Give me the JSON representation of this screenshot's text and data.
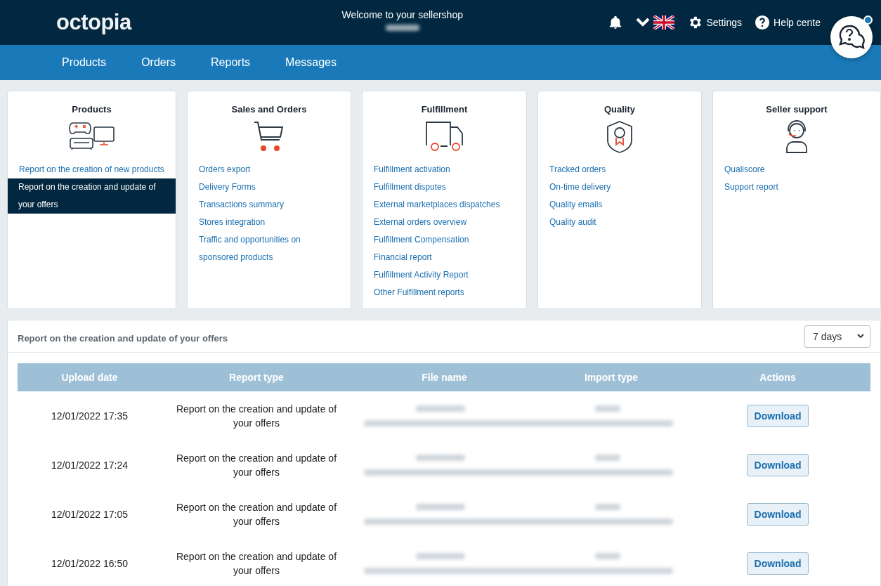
{
  "header": {
    "logo": "octopia",
    "welcome": "Welcome to your sellershop",
    "settings": "Settings",
    "help": "Help cente"
  },
  "nav": [
    "Products",
    "Orders",
    "Reports",
    "Messages"
  ],
  "cards": [
    {
      "title": "Products",
      "kind": "products",
      "links": [
        {
          "label": "Report on the creation of new products",
          "selected": false
        },
        {
          "label": "Report on the creation and update of your offers",
          "selected": true
        }
      ]
    },
    {
      "title": "Sales and Orders",
      "kind": "cart",
      "links": [
        {
          "label": "Orders export",
          "selected": false
        },
        {
          "label": "Delivery Forms",
          "selected": false
        },
        {
          "label": "Transactions summary",
          "selected": false
        },
        {
          "label": "Stores integration",
          "selected": false
        },
        {
          "label": "Traffic and opportunities on sponsored products",
          "selected": false
        }
      ]
    },
    {
      "title": "Fulfillment",
      "kind": "truck",
      "links": [
        {
          "label": "Fulfillment activation",
          "selected": false
        },
        {
          "label": "Fulfillment disputes",
          "selected": false
        },
        {
          "label": "External marketplaces dispatches",
          "selected": false
        },
        {
          "label": "External orders overview",
          "selected": false
        },
        {
          "label": "Fulfillment Compensation",
          "selected": false
        },
        {
          "label": "Financial report",
          "selected": false
        },
        {
          "label": "Fulfillment Activity Report",
          "selected": false
        },
        {
          "label": "Other Fulfillment reports",
          "selected": false
        }
      ]
    },
    {
      "title": "Quality",
      "kind": "badge",
      "links": [
        {
          "label": "Tracked orders",
          "selected": false
        },
        {
          "label": "On-time delivery",
          "selected": false
        },
        {
          "label": "Quality emails",
          "selected": false
        },
        {
          "label": "Quality audit",
          "selected": false
        }
      ]
    },
    {
      "title": "Seller support",
      "kind": "support",
      "links": [
        {
          "label": "Qualiscore",
          "selected": false
        },
        {
          "label": "Support report",
          "selected": false
        }
      ]
    }
  ],
  "report": {
    "title": "Report on the creation and update of your offers",
    "period": "7 days",
    "columns": [
      "Upload date",
      "Report type",
      "File name",
      "Import type",
      "Actions"
    ],
    "rows": [
      {
        "date": "12/01/2022 17:35",
        "type": "Report on the creation and update of your offers",
        "action": "Download"
      },
      {
        "date": "12/01/2022 17:24",
        "type": "Report on the creation and update of your offers",
        "action": "Download"
      },
      {
        "date": "12/01/2022 17:05",
        "type": "Report on the creation and update of your offers",
        "action": "Download"
      },
      {
        "date": "12/01/2022 16:50",
        "type": "Report on the creation and update of your offers",
        "action": "Download"
      }
    ]
  }
}
